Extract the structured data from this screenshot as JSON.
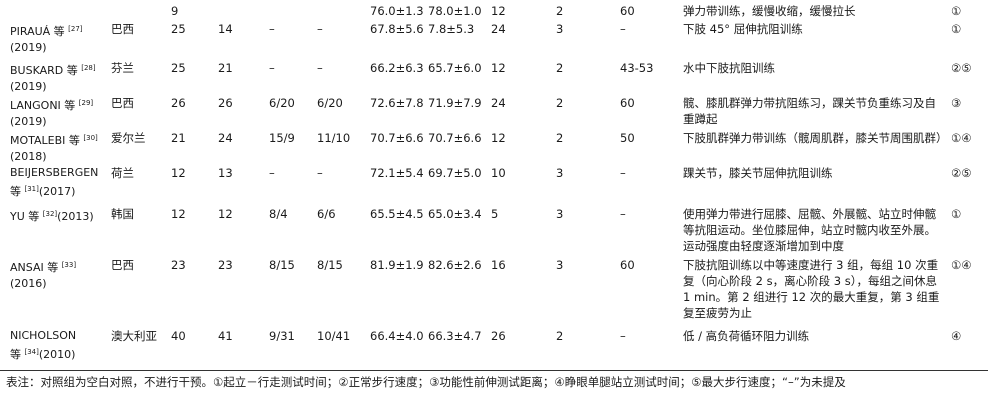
{
  "table": {
    "rows": [
      {
        "author": "",
        "ref": "",
        "year": "",
        "country": "",
        "n1": "9",
        "n2": "",
        "mf1": "",
        "mf2": "",
        "age1": "76.0±1.3",
        "age2": "78.0±1.0",
        "weeks": "12",
        "freq": "2",
        "dur": "60",
        "intervention": "弹力带训练，缓慢收缩，缓慢拉长",
        "outcome": "①"
      },
      {
        "author": "PIRAUÁ 等 ",
        "ref": "[27]",
        "year": "(2019)",
        "country": "巴西",
        "n1": "25",
        "n2": "14",
        "mf1": "–",
        "mf2": "–",
        "age1": "67.8±5.6",
        "age2": "7.8±5.3",
        "weeks": "24",
        "freq": "3",
        "dur": "–",
        "intervention": "下肢 45° 屈伸抗阻训练",
        "outcome": "①"
      },
      {
        "author": "BUSKARD 等 ",
        "ref": "[28]",
        "year": "(2019)",
        "country": "芬兰",
        "n1": "25",
        "n2": "21",
        "mf1": "–",
        "mf2": "–",
        "age1": "66.2±6.3",
        "age2": "65.7±6.0",
        "weeks": "12",
        "freq": "2",
        "dur": "43-53",
        "intervention": "水中下肢抗阻训练",
        "outcome": "②⑤"
      },
      {
        "author": "LANGONI 等 ",
        "ref": "[29]",
        "year": "(2019)",
        "country": "巴西",
        "n1": "26",
        "n2": "26",
        "mf1": "6/20",
        "mf2": "6/20",
        "age1": "72.6±7.8",
        "age2": "71.9±7.9",
        "weeks": "24",
        "freq": "2",
        "dur": "60",
        "intervention": "髋、膝肌群弹力带抗阻练习，踝关节负重练习及自重蹲起",
        "outcome": "③"
      },
      {
        "author": "MOTALEBI 等 ",
        "ref": "[30]",
        "year": "(2018)",
        "country": "爱尔兰",
        "n1": "21",
        "n2": "24",
        "mf1": "15/9",
        "mf2": "11/10",
        "age1": "70.7±6.6",
        "age2": "70.7±6.6",
        "weeks": "12",
        "freq": "2",
        "dur": "50",
        "intervention": "下肢肌群弹力带训练（髋周肌群，膝关节周围肌群）",
        "outcome": "①④"
      },
      {
        "author": "BEIJERSBERGEN",
        "ref": "[31]",
        "year": "(2017)",
        "author_line2": "等 ",
        "country": "荷兰",
        "n1": "12",
        "n2": "13",
        "mf1": "–",
        "mf2": "–",
        "age1": "72.1±5.4",
        "age2": "69.7±5.0",
        "weeks": "10",
        "freq": "3",
        "dur": "–",
        "intervention": "踝关节，膝关节屈伸抗阻训练",
        "outcome": "②⑤"
      },
      {
        "author": "YU 等 ",
        "ref": "[32]",
        "year": "(2013)",
        "country": "韩国",
        "n1": "12",
        "n2": "12",
        "mf1": "8/4",
        "mf2": "6/6",
        "age1": "65.5±4.5",
        "age2": "65.0±3.4",
        "weeks": "5",
        "freq": "3",
        "dur": "–",
        "intervention": "使用弹力带进行屈膝、屈髋、外展髋、站立时伸髋等抗阻运动。坐位膝屈伸，站立时髋内收至外展。运动强度由轻度逐渐增加到中度",
        "outcome": "①"
      },
      {
        "author": "ANSAI 等 ",
        "ref": "[33]",
        "year": "(2016)",
        "country": "巴西",
        "n1": "23",
        "n2": "23",
        "mf1": "8/15",
        "mf2": "8/15",
        "age1": "81.9±1.9",
        "age2": "82.6±2.6",
        "weeks": "16",
        "freq": "3",
        "dur": "60",
        "intervention": "下肢抗阻训练以中等速度进行 3 组，每组 10 次重复（向心阶段 2 s，离心阶段 3 s），每组之间休息 1 min。第 2 组进行 12 次的最大重复，第 3 组重复至疲劳为止",
        "outcome": "①④"
      },
      {
        "author": "NICHOLSON",
        "ref": "[34]",
        "year": "(2010)",
        "author_line2": "等 ",
        "country": "澳大利亚",
        "n1": "40",
        "n2": "41",
        "mf1": "9/31",
        "mf2": "10/41",
        "age1": "66.4±4.0",
        "age2": "66.3±4.7",
        "weeks": "26",
        "freq": "2",
        "dur": "–",
        "intervention": "低 / 高负荷循环阻力训练",
        "outcome": "④"
      }
    ]
  },
  "footnote": "表注：对照组为空白对照，不进行干预。①起立－行走测试时间；②正常步行速度；③功能性前伸测试距离；④睁眼单腿站立测试时间；⑤最大步行速度；“–”为未提及"
}
